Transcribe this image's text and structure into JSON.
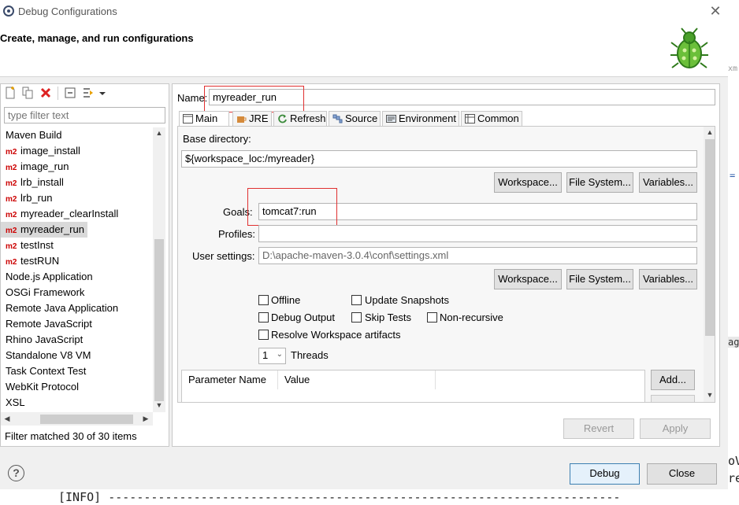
{
  "window": {
    "title": "Debug Configurations",
    "close_symbol": "✕"
  },
  "header": {
    "title": "Create, manage, and run configurations"
  },
  "left": {
    "filter_placeholder": "type filter text",
    "tree": [
      {
        "label": "Maven Build",
        "m2": false
      },
      {
        "label": "image_install",
        "m2": true
      },
      {
        "label": "image_run",
        "m2": true
      },
      {
        "label": "lrb_install",
        "m2": true
      },
      {
        "label": "lrb_run",
        "m2": true
      },
      {
        "label": "myreader_clearInstall",
        "m2": true
      },
      {
        "label": "myreader_run",
        "m2": true,
        "selected": true
      },
      {
        "label": "testInst",
        "m2": true
      },
      {
        "label": "testRUN",
        "m2": true
      },
      {
        "label": "Node.js Application",
        "m2": false
      },
      {
        "label": "OSGi Framework",
        "m2": false
      },
      {
        "label": "Remote Java Application",
        "m2": false
      },
      {
        "label": "Remote JavaScript",
        "m2": false
      },
      {
        "label": "Rhino JavaScript",
        "m2": false
      },
      {
        "label": "Standalone V8 VM",
        "m2": false
      },
      {
        "label": "Task Context Test",
        "m2": false
      },
      {
        "label": "WebKit Protocol",
        "m2": false
      },
      {
        "label": "XSL",
        "m2": false
      }
    ],
    "m2_badge": "m2",
    "filter_status": "Filter matched 30 of 30 items"
  },
  "right": {
    "name_label": "Name:",
    "name_value": "myreader_run",
    "tabs": [
      "Main",
      "JRE",
      "Refresh",
      "Source",
      "Environment",
      "Common"
    ],
    "base_dir_label": "Base directory:",
    "base_dir_value": "${workspace_loc:/myreader}",
    "workspace_btn": "Workspace...",
    "filesystem_btn": "File System...",
    "variables_btn": "Variables...",
    "goals_label": "Goals:",
    "goals_value": "tomcat7:run",
    "profiles_label": "Profiles:",
    "profiles_value": "",
    "user_settings_label": "User settings:",
    "user_settings_value": "D:\\apache-maven-3.0.4\\conf\\settings.xml",
    "options": {
      "offline": "Offline",
      "update_snapshots": "Update Snapshots",
      "debug_output": "Debug Output",
      "skip_tests": "Skip Tests",
      "non_recursive": "Non-recursive",
      "resolve_workspace": "Resolve Workspace artifacts"
    },
    "threads_value": "1",
    "threads_label": "Threads",
    "param_headers": [
      "Parameter Name",
      "Value"
    ],
    "add_btn": "Add...",
    "revert_btn": "Revert",
    "apply_btn": "Apply"
  },
  "footer": {
    "help": "?",
    "debug_btn": "Debug",
    "close_btn": "Close",
    "console_text": "[INFO] ------------------------------------------------------------------------"
  },
  "background_snippets": {
    "right_edge": [
      "xm",
      "=",
      "ag",
      "oV",
      "re"
    ]
  },
  "colors": {
    "accent_red": "#e03030",
    "m2_red": "#cc0000",
    "selection": "#d9d9d9"
  }
}
